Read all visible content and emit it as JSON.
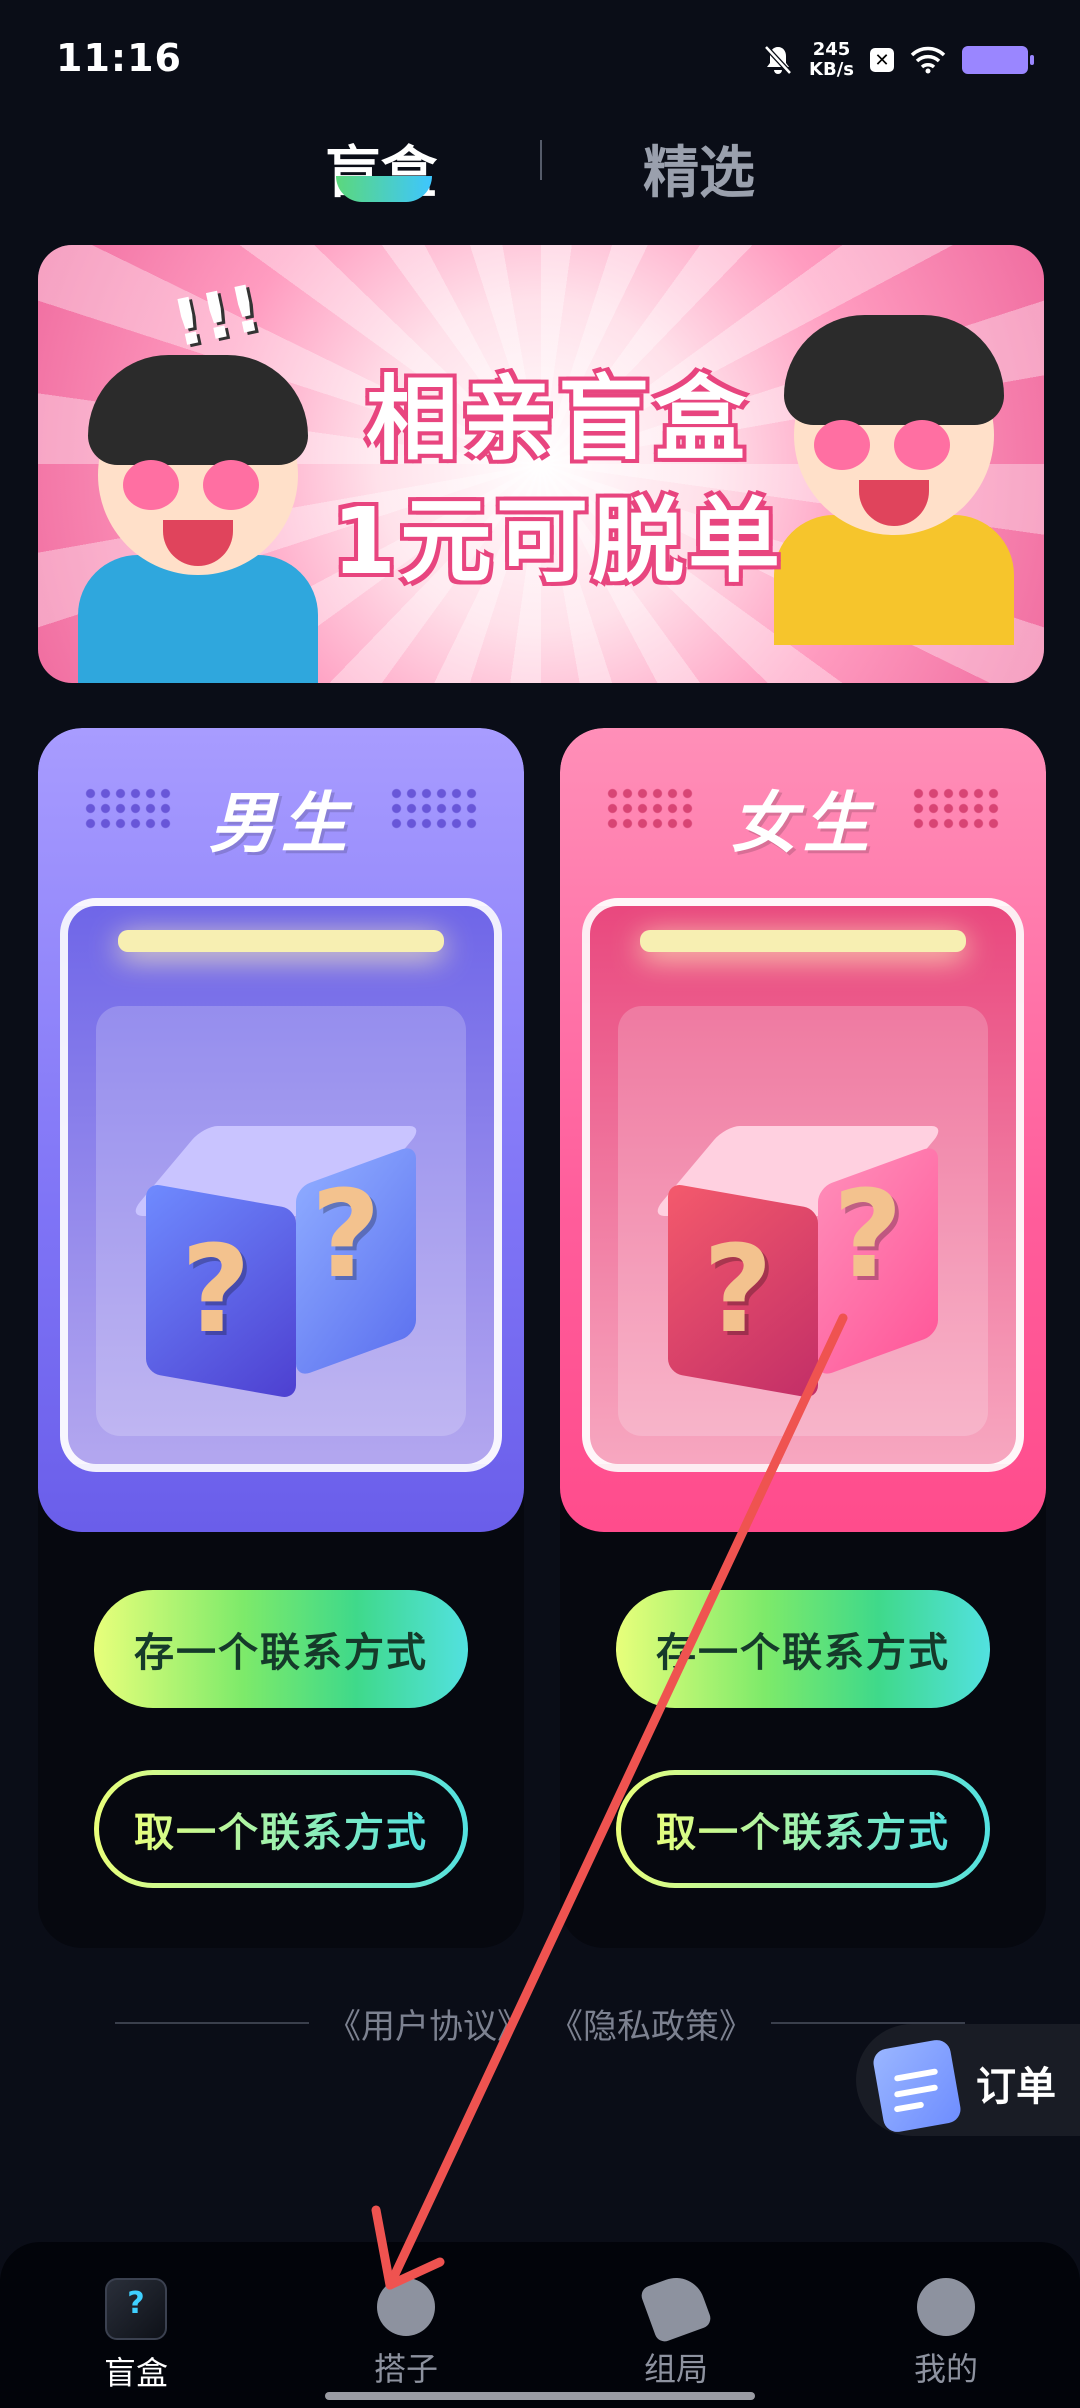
{
  "status_bar": {
    "time": "11:16",
    "net_speed_value": "245",
    "net_speed_unit": "KB/s",
    "icons": [
      "mute-bell-icon",
      "x-app-icon",
      "wifi-icon",
      "battery-icon"
    ]
  },
  "top_tabs": [
    {
      "label": "盲盒",
      "selected": true
    },
    {
      "label": "精选",
      "selected": false
    }
  ],
  "banner": {
    "title": "相亲盲盒",
    "subtitle": "1元可脱单",
    "exclamation": "!!!"
  },
  "cards": [
    {
      "title": "男生",
      "question_mark": "?",
      "save_button": "存一个联系方式",
      "take_button": "取一个联系方式"
    },
    {
      "title": "女生",
      "question_mark": "?",
      "save_button": "存一个联系方式",
      "take_button": "取一个联系方式"
    }
  ],
  "policy": {
    "user_agreement": "《用户协议》",
    "privacy_policy": "《隐私政策》"
  },
  "orders_float": {
    "label": "订单"
  },
  "bottom_nav": [
    {
      "label": "盲盒",
      "icon": "blindbox-cube-icon",
      "active": true
    },
    {
      "label": "搭子",
      "icon": "chat-bubble-icon",
      "active": false
    },
    {
      "label": "组局",
      "icon": "megaphone-icon",
      "active": false
    },
    {
      "label": "我的",
      "icon": "profile-icon",
      "active": false
    }
  ],
  "colors": {
    "background": "#0a0d17",
    "male_card": "#7f74f6",
    "female_card": "#ff5d9b",
    "button_gradient_start": "#e8ff7b",
    "button_gradient_end": "#52e1e0",
    "annotation_arrow": "#ef5350"
  }
}
